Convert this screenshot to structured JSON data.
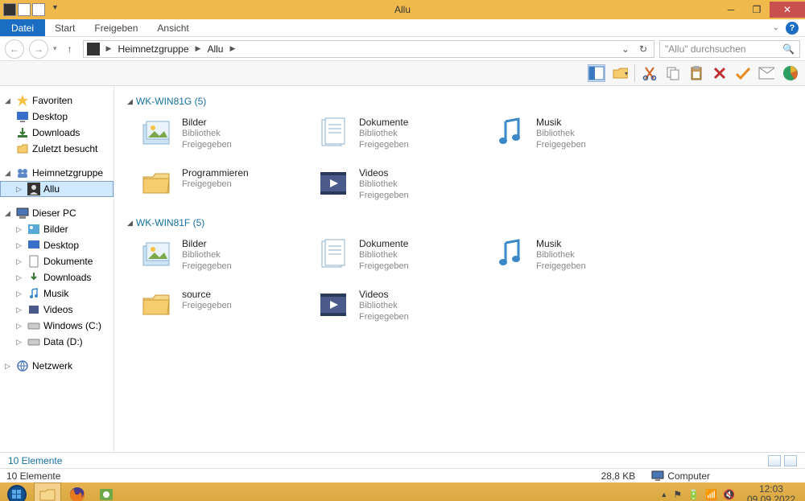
{
  "window": {
    "title": "Allu"
  },
  "menu": {
    "file": "Datei",
    "start": "Start",
    "share": "Freigeben",
    "view": "Ansicht"
  },
  "address": {
    "crumb1": "Heimnetzgruppe",
    "crumb2": "Allu"
  },
  "search": {
    "placeholder": "\"Allu\" durchsuchen"
  },
  "sidebar": {
    "favorites": {
      "label": "Favoriten",
      "desktop": "Desktop",
      "downloads": "Downloads",
      "recent": "Zuletzt besucht"
    },
    "homegroup": {
      "label": "Heimnetzgruppe",
      "allu": "Allu"
    },
    "pc": {
      "label": "Dieser PC",
      "bilder": "Bilder",
      "desktop": "Desktop",
      "dokumente": "Dokumente",
      "downloads": "Downloads",
      "musik": "Musik",
      "videos": "Videos",
      "c": "Windows (C:)",
      "d": "Data (D:)"
    },
    "network": {
      "label": "Netzwerk"
    }
  },
  "groups": [
    {
      "name": "WK-WIN81G (5)",
      "items": [
        {
          "name": "Bilder",
          "line1": "Bibliothek",
          "line2": "Freigegeben",
          "icon": "library-pictures"
        },
        {
          "name": "Dokumente",
          "line1": "Bibliothek",
          "line2": "Freigegeben",
          "icon": "library-documents"
        },
        {
          "name": "Musik",
          "line1": "Bibliothek",
          "line2": "Freigegeben",
          "icon": "library-music"
        },
        {
          "name": "Programmieren",
          "line1": "Freigegeben",
          "line2": "",
          "icon": "folder"
        },
        {
          "name": "Videos",
          "line1": "Bibliothek",
          "line2": "Freigegeben",
          "icon": "library-videos"
        }
      ]
    },
    {
      "name": "WK-WIN81F (5)",
      "items": [
        {
          "name": "Bilder",
          "line1": "Bibliothek",
          "line2": "Freigegeben",
          "icon": "library-pictures"
        },
        {
          "name": "Dokumente",
          "line1": "Bibliothek",
          "line2": "Freigegeben",
          "icon": "library-documents"
        },
        {
          "name": "Musik",
          "line1": "Bibliothek",
          "line2": "Freigegeben",
          "icon": "library-music"
        },
        {
          "name": "source",
          "line1": "Freigegeben",
          "line2": "",
          "icon": "folder"
        },
        {
          "name": "Videos",
          "line1": "Bibliothek",
          "line2": "Freigegeben",
          "icon": "library-videos"
        }
      ]
    }
  ],
  "status": {
    "count": "10 Elemente",
    "size": "28,8 KB",
    "location": "Computer"
  },
  "clock": {
    "time": "12:03",
    "date": "09.09.2022"
  }
}
